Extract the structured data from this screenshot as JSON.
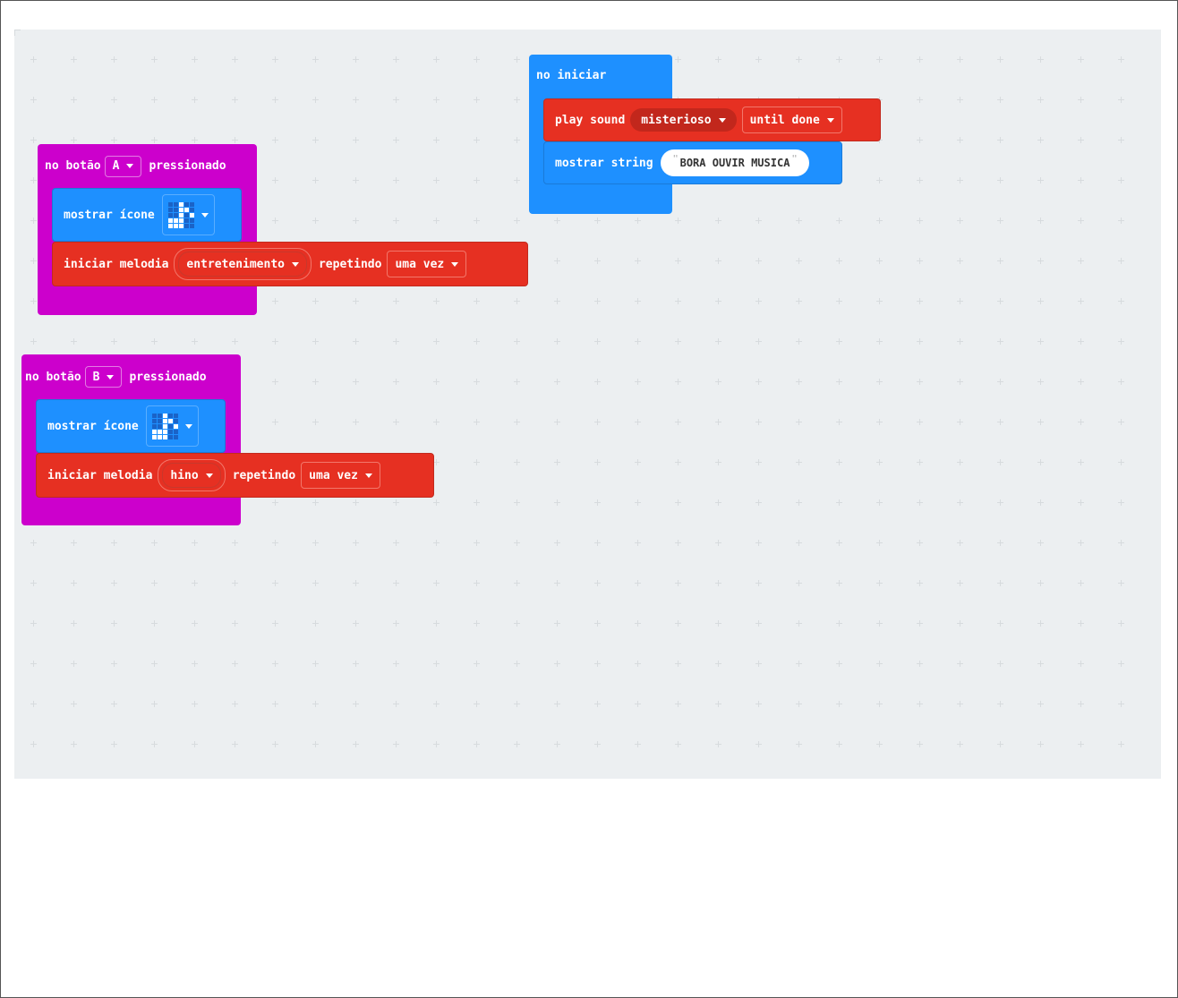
{
  "colors": {
    "workspace_bg": "#eceff1",
    "input_event": "#cc00cc",
    "basic": "#1e90ff",
    "music": "#e63022"
  },
  "on_start": {
    "title": "no iniciar",
    "play_sound": {
      "label": "play sound",
      "sound": "misterioso",
      "mode": "until done"
    },
    "show_string": {
      "label": "mostrar string",
      "value": "BORA OUVIR MUSICA"
    }
  },
  "button_a": {
    "prefix": "no botão",
    "button": "A",
    "suffix": "pressionado",
    "show_icon": {
      "label": "mostrar ícone",
      "icon": "eighth-note-icon"
    },
    "melody": {
      "label": "iniciar melodia",
      "melody": "entretenimento",
      "repeat_label": "repetindo",
      "repeat": "uma vez"
    }
  },
  "button_b": {
    "prefix": "no botão",
    "button": "B",
    "suffix": "pressionado",
    "show_icon": {
      "label": "mostrar ícone",
      "icon": "eighth-note-icon"
    },
    "melody": {
      "label": "iniciar melodia",
      "melody": "hino",
      "repeat_label": "repetindo",
      "repeat": "uma vez"
    }
  }
}
